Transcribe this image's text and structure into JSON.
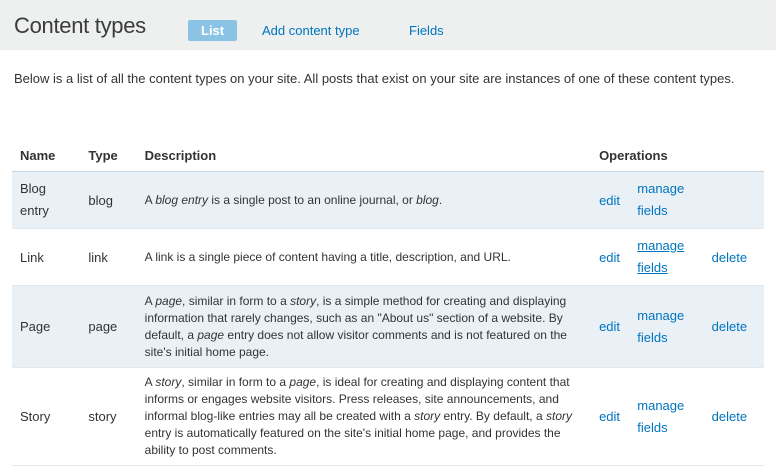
{
  "header": {
    "title": "Content types",
    "tabs": [
      {
        "label": "List",
        "active": true
      },
      {
        "label": "Add content type",
        "active": false
      },
      {
        "label": "Fields",
        "active": false
      }
    ]
  },
  "intro": "Below is a list of all the content types on your site. All posts that exist on your site are instances of one of these content types.",
  "table": {
    "headers": {
      "name": "Name",
      "type": "Type",
      "description": "Description",
      "operations": "Operations"
    },
    "rows": [
      {
        "name": "Blog entry",
        "type": "blog",
        "description": [
          {
            "t": "A "
          },
          {
            "t": "blog entry",
            "em": true
          },
          {
            "t": " is a single post to an online journal, or "
          },
          {
            "t": "blog",
            "em": true
          },
          {
            "t": "."
          }
        ],
        "edit": "edit",
        "manage_1": "manage",
        "manage_2": "fields",
        "delete": ""
      },
      {
        "name": "Link",
        "type": "link",
        "description": [
          {
            "t": "A link is a single piece of content having a title, description, and URL."
          }
        ],
        "edit": "edit",
        "manage_1": "manage",
        "manage_2": "fields",
        "delete": "delete"
      },
      {
        "name": "Page",
        "type": "page",
        "description": [
          {
            "t": "A "
          },
          {
            "t": "page",
            "em": true
          },
          {
            "t": ", similar in form to a "
          },
          {
            "t": "story",
            "em": true
          },
          {
            "t": ", is a simple method for creating and displaying information that rarely changes, such as an \"About us\" section of a website. By default, a "
          },
          {
            "t": "page",
            "em": true
          },
          {
            "t": " entry does not allow visitor comments and is not featured on the site's initial home page."
          }
        ],
        "edit": "edit",
        "manage_1": "manage",
        "manage_2": "fields",
        "delete": "delete"
      },
      {
        "name": "Story",
        "type": "story",
        "description": [
          {
            "t": "A "
          },
          {
            "t": "story",
            "em": true
          },
          {
            "t": ", similar in form to a "
          },
          {
            "t": "page",
            "em": true
          },
          {
            "t": ", is ideal for creating and displaying content that informs or engages website visitors. Press releases, site announcements, and informal blog-like entries may all be created with a "
          },
          {
            "t": "story",
            "em": true
          },
          {
            "t": " entry. By default, a "
          },
          {
            "t": "story",
            "em": true
          },
          {
            "t": " entry is automatically featured on the site's initial home page, and provides the ability to post comments."
          }
        ],
        "edit": "edit",
        "manage_1": "manage",
        "manage_2": "fields",
        "delete": "delete"
      }
    ]
  },
  "colors": {
    "link": "#0074bd",
    "active_tab": "#8bc3e5",
    "header_bg": "#eef0f0",
    "row_odd": "#e9f1f7"
  }
}
